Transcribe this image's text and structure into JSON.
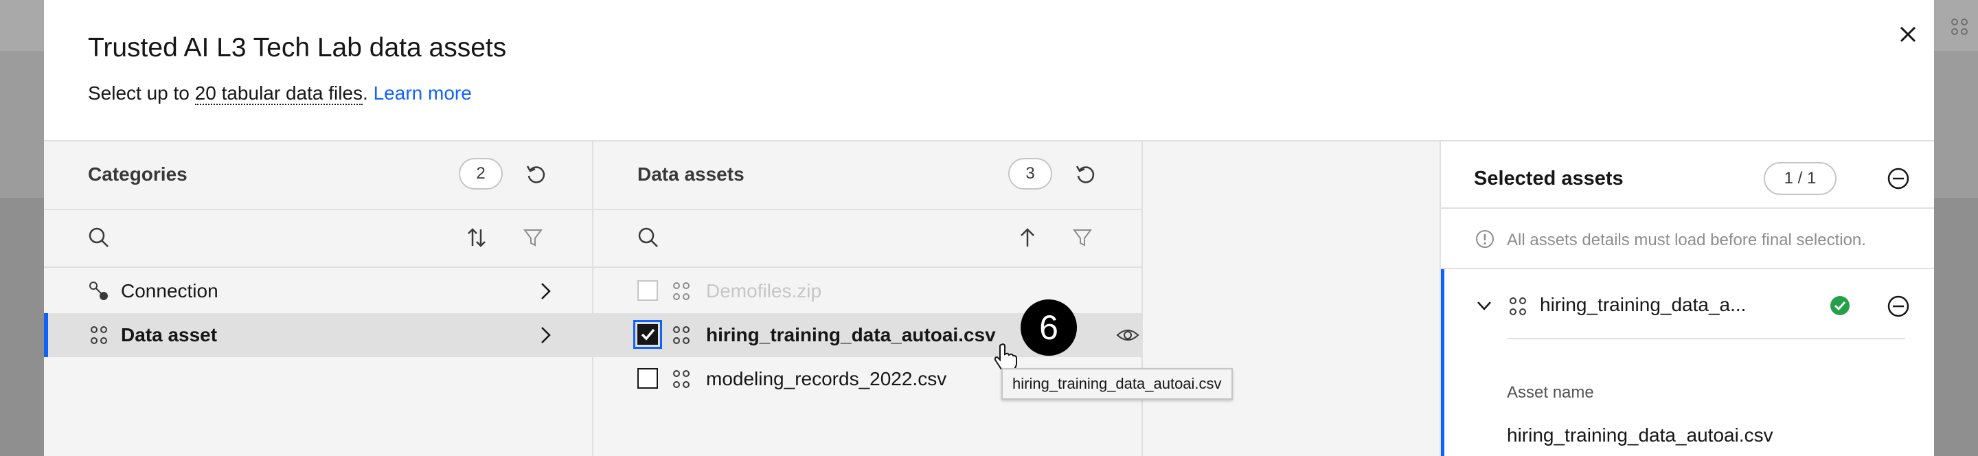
{
  "modal": {
    "title": "Trusted AI L3 Tech Lab data assets",
    "subtitle_prefix": "Select up to ",
    "subtitle_link": "20 tabular data files",
    "subtitle_period": ".",
    "learn_more": "Learn more"
  },
  "categories": {
    "title": "Categories",
    "count": "2",
    "items": [
      {
        "label": "Connection",
        "icon": "connection-icon",
        "selected": false
      },
      {
        "label": "Data asset",
        "icon": "data-asset-icon",
        "selected": true
      }
    ]
  },
  "data_assets": {
    "title": "Data assets",
    "count": "3",
    "items": [
      {
        "label": "Demofiles.zip",
        "state": "disabled"
      },
      {
        "label": "hiring_training_data_autoai.csv",
        "state": "checked"
      },
      {
        "label": "modeling_records_2022.csv",
        "state": "unchecked"
      }
    ],
    "tooltip": "hiring_training_data_autoai.csv",
    "step_badge": "6"
  },
  "selected_assets": {
    "title": "Selected assets",
    "count": "1 / 1",
    "info": "All assets details must load before final selection.",
    "item_name": "hiring_training_data_a...",
    "asset_name_label": "Asset name",
    "asset_name_value": "hiring_training_data_autoai.csv"
  },
  "colors": {
    "accent": "#0f62fe",
    "success": "#24a148",
    "overlay": "#9c9c9c"
  }
}
